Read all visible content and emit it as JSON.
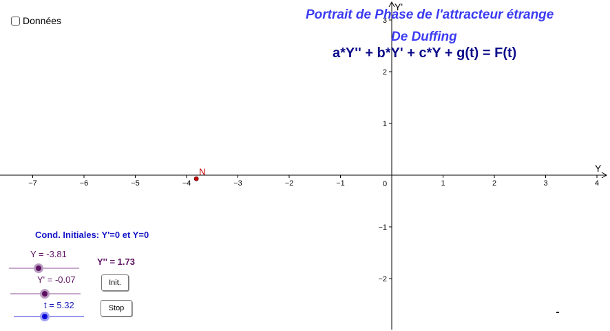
{
  "checkbox": {
    "label": "Données",
    "checked": false
  },
  "title": {
    "line1": "Portrait de Phase de l'attracteur étrange",
    "line2": "De Duffing",
    "equation": "a*Y'' + b*Y' + c*Y + g(t) = F(t)"
  },
  "graph": {
    "x_axis_label": "Y",
    "y_axis_label": "Y'",
    "origin_label": "0",
    "x_ticks": [
      -7,
      -6,
      -5,
      -4,
      -3,
      -2,
      -1,
      1,
      2,
      3,
      4
    ],
    "y_ticks": [
      -2,
      -1,
      1,
      2,
      3
    ],
    "point": {
      "name": "N",
      "x": -3.81,
      "y": -0.07,
      "color": "#cc0000"
    },
    "axis_color": "#000000"
  },
  "controls": {
    "initial_conditions_text": "Cond. Initiales: Y'=0 et Y=0",
    "ypp_readout": "Y'' = 1.73",
    "sliders": [
      {
        "label": "Y = -3.81",
        "value": -3.81,
        "color": "#5c1060"
      },
      {
        "label": "Y' = -0.07",
        "value": -0.07,
        "color": "#5c1060"
      },
      {
        "label": "t = 5.32",
        "value": 5.32,
        "color": "#1a1ab8"
      }
    ],
    "buttons": {
      "init_label": "Init.",
      "stop_label": "Stop"
    }
  },
  "colors": {
    "title": "#3b3bf2",
    "equation": "#0d0d8a",
    "condition_text": "#1515c8",
    "slider_purple": "#5c1060",
    "slider_blue": "#1a1ab8"
  }
}
